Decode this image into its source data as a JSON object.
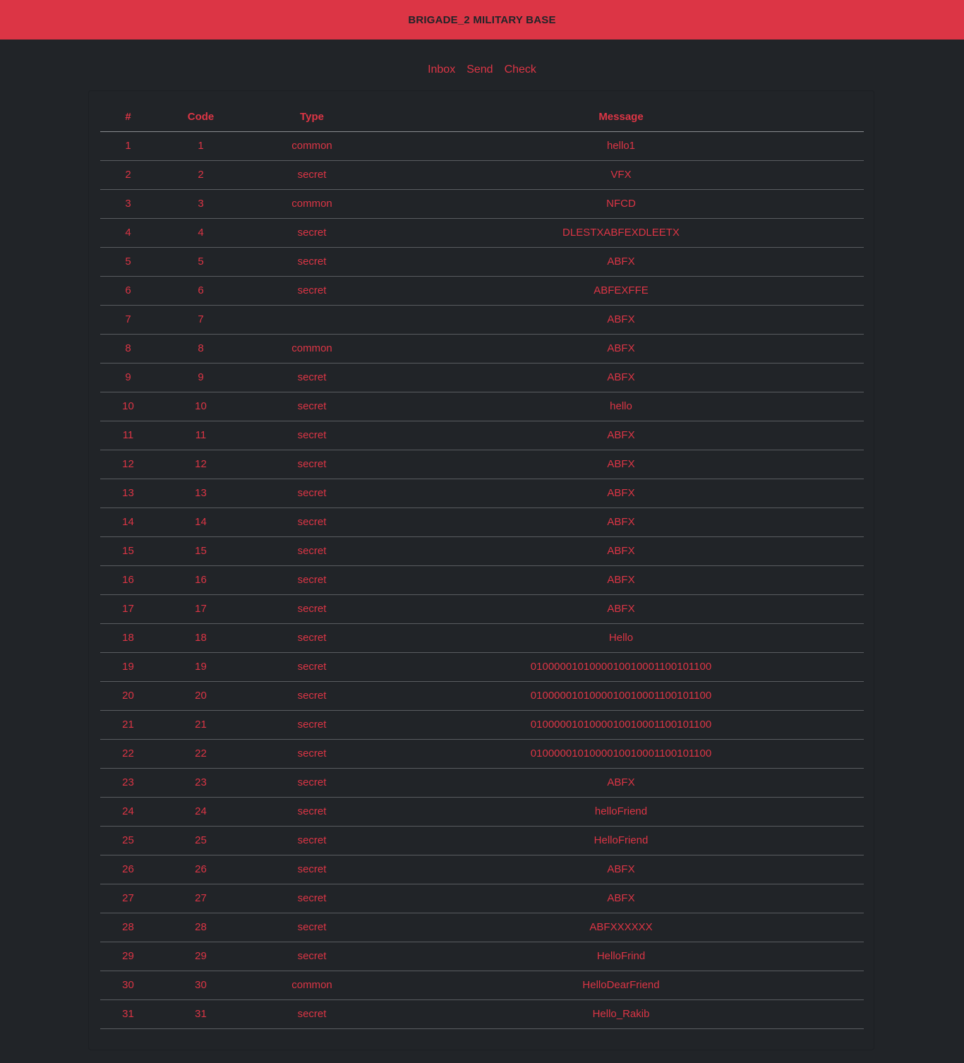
{
  "header": {
    "title": "BRIGADE_2 MILITARY BASE"
  },
  "nav": {
    "inbox": "Inbox",
    "send": "Send",
    "check": "Check"
  },
  "table": {
    "columns": {
      "num": "#",
      "code": "Code",
      "type": "Type",
      "message": "Message"
    },
    "rows": [
      {
        "num": "1",
        "code": "1",
        "type": "common",
        "message": "hello1"
      },
      {
        "num": "2",
        "code": "2",
        "type": "secret",
        "message": "VFX"
      },
      {
        "num": "3",
        "code": "3",
        "type": "common",
        "message": "NFCD"
      },
      {
        "num": "4",
        "code": "4",
        "type": "secret",
        "message": "DLESTXABFEXDLEETX"
      },
      {
        "num": "5",
        "code": "5",
        "type": "secret",
        "message": "ABFX"
      },
      {
        "num": "6",
        "code": "6",
        "type": "secret",
        "message": "ABFEXFFE"
      },
      {
        "num": "7",
        "code": "7",
        "type": "",
        "message": "ABFX"
      },
      {
        "num": "8",
        "code": "8",
        "type": "common",
        "message": "ABFX"
      },
      {
        "num": "9",
        "code": "9",
        "type": "secret",
        "message": "ABFX"
      },
      {
        "num": "10",
        "code": "10",
        "type": "secret",
        "message": "hello"
      },
      {
        "num": "11",
        "code": "11",
        "type": "secret",
        "message": "ABFX"
      },
      {
        "num": "12",
        "code": "12",
        "type": "secret",
        "message": "ABFX"
      },
      {
        "num": "13",
        "code": "13",
        "type": "secret",
        "message": "ABFX"
      },
      {
        "num": "14",
        "code": "14",
        "type": "secret",
        "message": "ABFX"
      },
      {
        "num": "15",
        "code": "15",
        "type": "secret",
        "message": "ABFX"
      },
      {
        "num": "16",
        "code": "16",
        "type": "secret",
        "message": "ABFX"
      },
      {
        "num": "17",
        "code": "17",
        "type": "secret",
        "message": "ABFX"
      },
      {
        "num": "18",
        "code": "18",
        "type": "secret",
        "message": "Hello"
      },
      {
        "num": "19",
        "code": "19",
        "type": "secret",
        "message": "0100000101000010010001100101100"
      },
      {
        "num": "20",
        "code": "20",
        "type": "secret",
        "message": "0100000101000010010001100101100"
      },
      {
        "num": "21",
        "code": "21",
        "type": "secret",
        "message": "0100000101000010010001100101100"
      },
      {
        "num": "22",
        "code": "22",
        "type": "secret",
        "message": "0100000101000010010001100101100"
      },
      {
        "num": "23",
        "code": "23",
        "type": "secret",
        "message": "ABFX"
      },
      {
        "num": "24",
        "code": "24",
        "type": "secret",
        "message": "helloFriend"
      },
      {
        "num": "25",
        "code": "25",
        "type": "secret",
        "message": "HelloFriend"
      },
      {
        "num": "26",
        "code": "26",
        "type": "secret",
        "message": "ABFX"
      },
      {
        "num": "27",
        "code": "27",
        "type": "secret",
        "message": "ABFX"
      },
      {
        "num": "28",
        "code": "28",
        "type": "secret",
        "message": "ABFXXXXXX"
      },
      {
        "num": "29",
        "code": "29",
        "type": "secret",
        "message": "HelloFrind"
      },
      {
        "num": "30",
        "code": "30",
        "type": "common",
        "message": "HelloDearFriend"
      },
      {
        "num": "31",
        "code": "31",
        "type": "secret",
        "message": "Hello_Rakib"
      }
    ]
  },
  "colors": {
    "accent": "#dc3545",
    "background": "#212428",
    "header_text": "#212529"
  }
}
